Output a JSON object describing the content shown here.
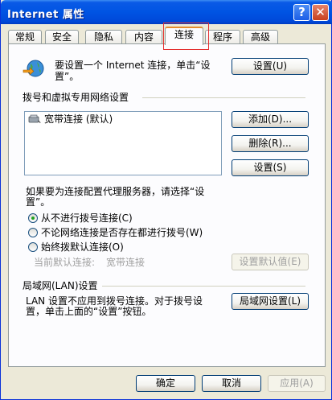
{
  "window": {
    "title": "Internet 属性",
    "help_glyph": "?",
    "close_glyph": "✕"
  },
  "tabs": [
    "常规",
    "安全",
    "隐私",
    "内容",
    "连接",
    "程序",
    "高级"
  ],
  "active_tab": "连接",
  "setup": {
    "text_line1": "要设置一个 Internet 连接，单击“设",
    "text_line2": "置”。",
    "button": "设置(U)"
  },
  "dialup": {
    "group_label": "拨号和虚拟专用网络设置",
    "connections": [
      "宽带连接 (默认)"
    ],
    "add_button": "添加(D)...",
    "remove_button": "删除(R)...",
    "settings_button": "设置(S)",
    "proxy_text_line1": "如果要为连接配置代理服务器，请选择“设",
    "proxy_text_line2": "置”。",
    "options": [
      "从不进行拨号连接(C)",
      "不论网络连接是否存在都进行拨号(W)",
      "始终拨默认连接(O)"
    ],
    "selected_option": 0,
    "current_default_label": "当前默认连接:",
    "current_default_value": "宽带连接",
    "set_default_button": "设置默认值(E)"
  },
  "lan": {
    "group_label": "局域网(LAN)设置",
    "text_line1": "LAN 设置不应用到拨号连接。对于拨号设",
    "text_line2": "置，单击上面的“设置”按钮。",
    "button": "局域网设置(L)"
  },
  "footer": {
    "ok": "确定",
    "cancel": "取消",
    "apply": "应用(A)"
  },
  "colors": {
    "titlebar": "#0054e3",
    "tab_accent": "#e68b2c",
    "highlight_box": "#e43030",
    "radio_dot": "#21a121"
  }
}
